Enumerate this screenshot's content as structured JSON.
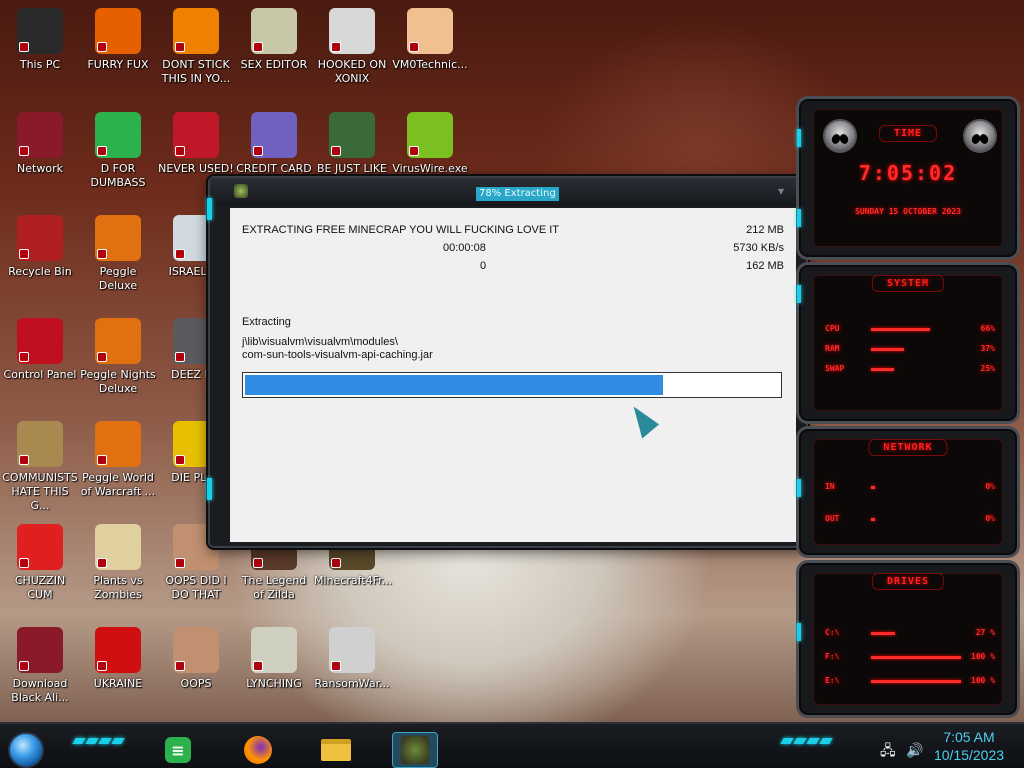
{
  "desktop_icons": [
    {
      "label": "This PC",
      "icon": "monitor-icon",
      "color": "#2a2a2a"
    },
    {
      "label": "FURRY FUX",
      "icon": "firefox-icon",
      "color": "#e66000"
    },
    {
      "label": "DONT STICK THIS IN YO...",
      "icon": "vlc-cone-icon",
      "color": "#f08000"
    },
    {
      "label": "SEX EDITOR",
      "icon": "hxd-icon",
      "color": "#c8c8a8"
    },
    {
      "label": "HOOKED ON XONIX",
      "icon": "game-icon",
      "color": "#d8d8d8"
    },
    {
      "label": "VM0Technic...",
      "icon": "doctor-icon",
      "color": "#f0c090"
    },
    {
      "label": "Network",
      "icon": "alien-skull-icon",
      "color": "#8a1a2a"
    },
    {
      "label": "D FOR DUMBASS",
      "icon": "feedly-icon",
      "color": "#2bb24c"
    },
    {
      "label": "NEVER USED!",
      "icon": "dev-cpp-icon",
      "color": "#c01828"
    },
    {
      "label": "CREDIT CARD",
      "icon": "credit-card-icon",
      "color": "#7060c0"
    },
    {
      "label": "BE JUST LIKE",
      "icon": "elf-icon",
      "color": "#3a6a3a"
    },
    {
      "label": "VirusWire.exe",
      "icon": "lime-icon",
      "color": "#7ac020"
    },
    {
      "label": "Recycle Bin",
      "icon": "trash-icon",
      "color": "#b02020"
    },
    {
      "label": "Peggle Deluxe",
      "icon": "peggle-icon",
      "color": "#e07010"
    },
    {
      "label": "ISRAEL SF",
      "icon": "bus-icon",
      "color": "#d0d8e0"
    },
    {
      "label": "Control Panel",
      "icon": "control-panel-icon",
      "color": "#c01020"
    },
    {
      "label": "Peggle Nights Deluxe",
      "icon": "peggle-icon",
      "color": "#e07010"
    },
    {
      "label": "DEEZ NU",
      "icon": "windows-stack-icon",
      "color": "#5a5a60"
    },
    {
      "label": "COMMUNISTS HATE THIS G...",
      "icon": "money-bag-icon",
      "color": "#a88a50"
    },
    {
      "label": "Peggle World of Warcraft ...",
      "icon": "peggle-icon",
      "color": "#e07010"
    },
    {
      "label": "DIE PLEA",
      "icon": "de-icon",
      "color": "#e8c000"
    },
    {
      "label": "CHUZZIN CUM",
      "icon": "chuzzle-icon",
      "color": "#e02020"
    },
    {
      "label": "Plants vs Zombies",
      "icon": "flower-icon",
      "color": "#e0d0a0"
    },
    {
      "label": "OOPS DID I DO THAT",
      "icon": "portrait-icon",
      "color": "#c09070"
    },
    {
      "label": "The Legend of Zilda",
      "icon": "zelda-icon",
      "color": "#5a3a2a"
    },
    {
      "label": "Minecraft4Fr...",
      "icon": "minecraft-icon",
      "color": "#5a4a2a"
    },
    {
      "label": "Download Black Ali...",
      "icon": "alien-skull-icon",
      "color": "#8a1a2a"
    },
    {
      "label": "UKRAINE",
      "icon": "radiation-icon",
      "color": "#d01010"
    },
    {
      "label": "OOPS",
      "icon": "portrait-icon",
      "color": "#c09070"
    },
    {
      "label": "LYNCHING",
      "icon": "badge-icon",
      "color": "#d0d0c0"
    },
    {
      "label": "RansomWar...",
      "icon": "skull-icon",
      "color": "#d0d0d0"
    }
  ],
  "extract_window": {
    "title": "78% Extracting",
    "headline": "EXTRACTING FREE MINECRAP YOU WILL FUCKING LOVE IT",
    "total_size": "212 MB",
    "elapsed": "00:00:08",
    "speed": "5730 KB/s",
    "remaining": "0",
    "processed": "162 MB",
    "status_label": "Extracting",
    "current_path_line1": "j\\lib\\visualvm\\visualvm\\modules\\",
    "current_path_line2": "com-sun-tools-visualvm-api-caching.jar",
    "progress_percent": 78,
    "progress_color": "#2f8de4"
  },
  "widget": {
    "time_header": "TIME",
    "time": "7:05:02",
    "date": "SUNDAY 15 OCTOBER 2023",
    "system_header": "SYSTEM",
    "system_stats": [
      {
        "name": "CPU",
        "value": "66%"
      },
      {
        "name": "RAM",
        "value": "37%"
      },
      {
        "name": "SWAP",
        "value": "25%"
      }
    ],
    "network_header": "NETWORK",
    "network_stats": [
      {
        "name": "IN",
        "value": "0%"
      },
      {
        "name": "OUT",
        "value": "0%"
      }
    ],
    "drives_header": "DRIVES",
    "drives": [
      {
        "name": "C:\\",
        "value": "27 %"
      },
      {
        "name": "F:\\",
        "value": "100 %"
      },
      {
        "name": "E:\\",
        "value": "100 %"
      }
    ],
    "accent": "#ff2a2a",
    "led_color": "#1ad0e8"
  },
  "taskbar": {
    "apps": [
      {
        "name": "feedly",
        "icon": "feedly-icon"
      },
      {
        "name": "firefox",
        "icon": "firefox-icon"
      },
      {
        "name": "file-explorer",
        "icon": "folder-icon"
      },
      {
        "name": "minecraft",
        "icon": "minecraft-icon",
        "active": true
      }
    ],
    "time": "7:05 AM",
    "date": "10/15/2023"
  }
}
